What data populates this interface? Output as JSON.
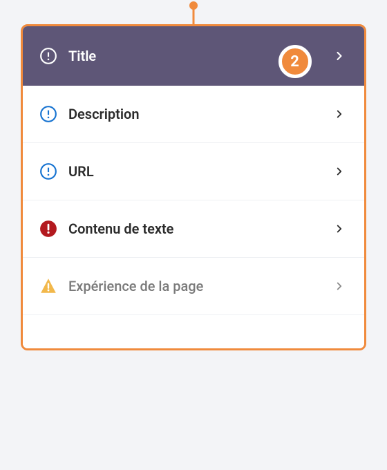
{
  "badge": {
    "value": "2"
  },
  "header": {
    "label": "Title",
    "icon": "alert-circle-outline",
    "icon_color": "#ffffff",
    "chevron_color": "#ffffff"
  },
  "rows": [
    {
      "label": "Description",
      "icon": "alert-circle-outline",
      "icon_color": "#1874d1"
    },
    {
      "label": "URL",
      "icon": "alert-circle-outline",
      "icon_color": "#1874d1"
    },
    {
      "label": "Contenu de texte",
      "icon": "alert-circle-filled",
      "icon_color": "#b3191f"
    },
    {
      "label": "Expérience de la page",
      "icon": "alert-triangle-filled",
      "icon_color": "#f2b84b",
      "muted": true
    }
  ]
}
